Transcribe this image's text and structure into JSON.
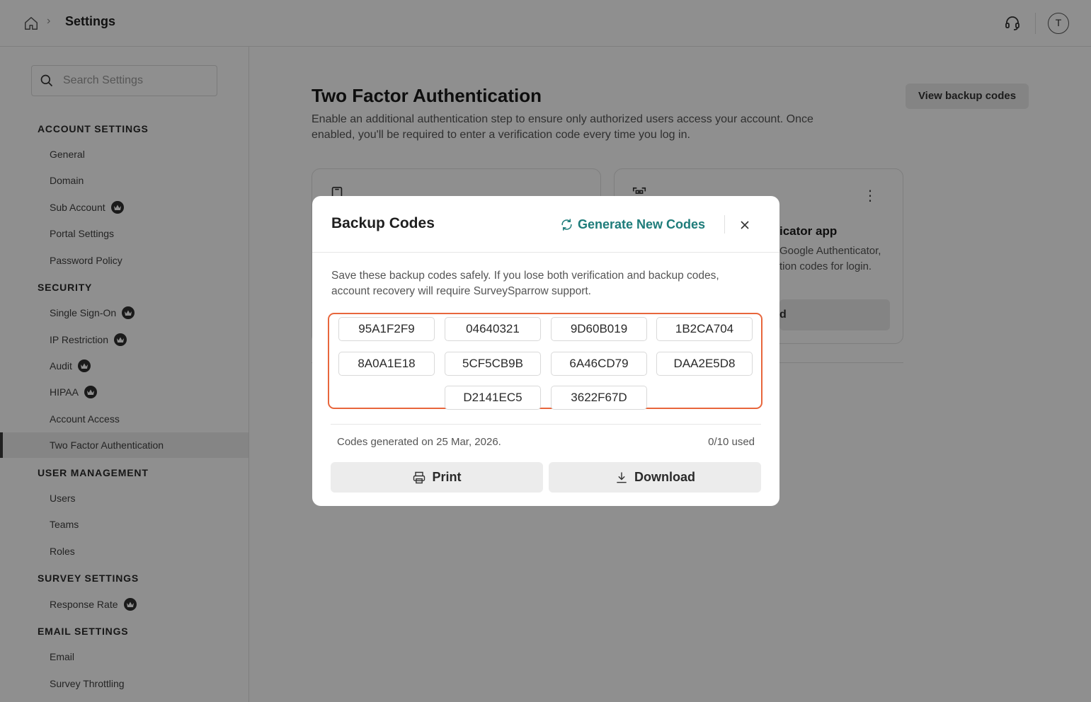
{
  "header": {
    "title": "Settings",
    "breadcrumb_separator": "›",
    "avatar_initial": "T"
  },
  "sidebar": {
    "search_placeholder": "Search Settings",
    "sections": [
      {
        "title": "ACCOUNT SETTINGS",
        "items": [
          {
            "label": "General",
            "premium": false
          },
          {
            "label": "Domain",
            "premium": false
          },
          {
            "label": "Sub Account",
            "premium": true
          },
          {
            "label": "Portal Settings",
            "premium": false
          },
          {
            "label": "Password Policy",
            "premium": false
          }
        ]
      },
      {
        "title": "SECURITY",
        "items": [
          {
            "label": "Single Sign-On",
            "premium": true
          },
          {
            "label": "IP Restriction",
            "premium": true
          },
          {
            "label": "Audit",
            "premium": true
          },
          {
            "label": "HIPAA",
            "premium": true
          },
          {
            "label": "Account Access",
            "premium": false
          },
          {
            "label": "Two Factor Authentication",
            "premium": false,
            "active": true
          }
        ]
      },
      {
        "title": "USER MANAGEMENT",
        "items": [
          {
            "label": "Users",
            "premium": false
          },
          {
            "label": "Teams",
            "premium": false
          },
          {
            "label": "Roles",
            "premium": false
          }
        ]
      },
      {
        "title": "SURVEY SETTINGS",
        "items": [
          {
            "label": "Response Rate",
            "premium": true
          }
        ]
      },
      {
        "title": "EMAIL SETTINGS",
        "items": [
          {
            "label": "Email",
            "premium": false
          },
          {
            "label": "Survey Throttling",
            "premium": false
          }
        ]
      }
    ]
  },
  "main": {
    "title": "Two Factor Authentication",
    "description": "Enable an additional authentication step to ensure only authorized users access your account. Once enabled, you'll be required to enter a verification code every time you log in.",
    "view_backup_codes_label": "View backup codes",
    "right_card": {
      "title_fragment": "icator app",
      "desc_fragment_1": "Google Authenticator,",
      "desc_fragment_2": "tion codes for login.",
      "button_fragment": "d"
    }
  },
  "modal": {
    "title": "Backup Codes",
    "generate_label": "Generate New Codes",
    "note": "Save these backup codes safely. If you lose both verification and backup codes, account recovery will require SurveySparrow support.",
    "codes": [
      "95A1F2F9",
      "04640321",
      "9D60B019",
      "1B2CA704",
      "8A0A1E18",
      "5CF5CB9B",
      "6A46CD79",
      "DAA2E5D8",
      "D2141EC5",
      "3622F67D"
    ],
    "generated_text": "Codes generated on 25 Mar, 2026.",
    "used_text": "0/10 used",
    "print_label": "Print",
    "download_label": "Download"
  },
  "colors": {
    "accent_teal": "#1e7c7a",
    "highlight_orange": "#e8663c",
    "overlay": "rgba(0,0,0,0.44)"
  }
}
